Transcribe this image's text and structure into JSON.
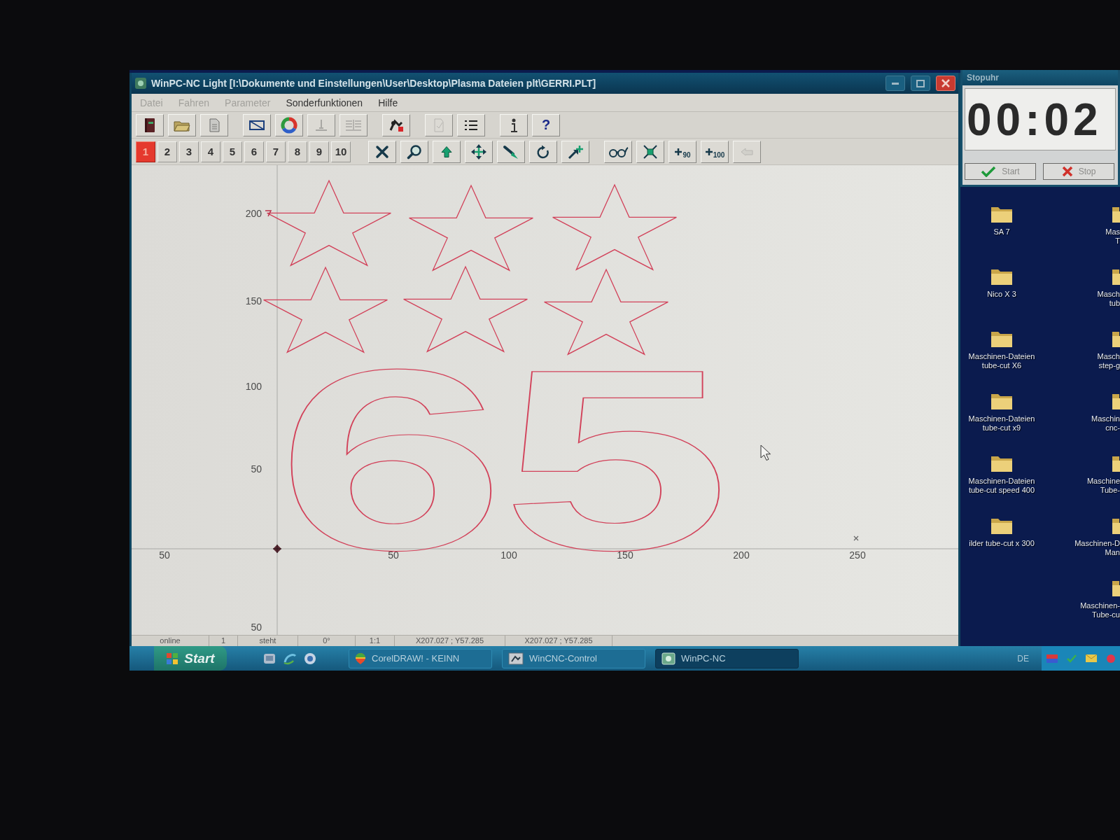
{
  "window": {
    "title": "WinPC-NC Light [I:\\Dokumente und Einstellungen\\User\\Desktop\\Plasma Dateien plt\\GERRI.PLT]"
  },
  "menu": [
    {
      "label": "Datei",
      "disabled": true
    },
    {
      "label": "Fahren",
      "disabled": true
    },
    {
      "label": "Parameter",
      "disabled": true
    },
    {
      "label": "Sonderfunktionen",
      "disabled": false
    },
    {
      "label": "Hilfe",
      "disabled": false
    }
  ],
  "toolbar": [
    {
      "kind": "icon",
      "disabled": false
    },
    {
      "kind": "icon",
      "disabled": false
    },
    {
      "kind": "icon",
      "disabled": false
    },
    {
      "kind": "icon",
      "disabled": false
    },
    {
      "kind": "icon",
      "disabled": false
    },
    {
      "kind": "icon",
      "disabled": true
    },
    {
      "kind": "icon",
      "disabled": true
    },
    {
      "kind": "icon",
      "disabled": false
    },
    {
      "kind": "icon",
      "disabled": true
    },
    {
      "kind": "icon",
      "disabled": false
    },
    {
      "kind": "icon",
      "disabled": false
    },
    {
      "kind": "glyph",
      "label": "?",
      "disabled": false
    }
  ],
  "program_slots": [
    {
      "label": "1",
      "selected": true
    },
    {
      "label": "2",
      "selected": false
    },
    {
      "label": "3",
      "selected": false
    },
    {
      "label": "4",
      "selected": false
    },
    {
      "label": "5",
      "selected": false
    },
    {
      "label": "6",
      "selected": false
    },
    {
      "label": "7",
      "selected": false
    },
    {
      "label": "8",
      "selected": false
    },
    {
      "label": "9",
      "selected": false
    },
    {
      "label": "10",
      "selected": false
    }
  ],
  "tools": [
    {
      "kind": "icon",
      "disabled": false
    },
    {
      "kind": "icon",
      "disabled": false
    },
    {
      "kind": "icon",
      "disabled": false
    },
    {
      "kind": "icon",
      "disabled": false
    },
    {
      "kind": "icon",
      "disabled": false
    },
    {
      "kind": "icon",
      "disabled": false
    },
    {
      "kind": "icon",
      "disabled": false
    },
    {
      "kind": "icon",
      "disabled": false
    },
    {
      "kind": "icon",
      "disabled": false
    },
    {
      "kind": "plus",
      "label": "90",
      "disabled": false
    },
    {
      "kind": "plus",
      "label": "100",
      "disabled": false
    },
    {
      "kind": "icon",
      "disabled": true
    }
  ],
  "canvas": {
    "x_labels": [
      "50",
      "50",
      "100",
      "150",
      "200",
      "250"
    ],
    "y_labels": [
      "200",
      "150",
      "100",
      "50",
      "50"
    ],
    "outline_text": "65"
  },
  "status_bar": [
    "online",
    "1",
    "steht",
    "0°",
    "1:1",
    "X207.027 ; Y57.285",
    "X207.027 ; Y57.285"
  ],
  "stopwatch": {
    "title": "Stopuhr",
    "time": "00:02",
    "buttons": [
      {
        "kind": "start",
        "label": "Start"
      },
      {
        "kind": "stop",
        "label": "Stop"
      }
    ]
  },
  "desktop": {
    "column_1": [
      {
        "label": "SA 7"
      },
      {
        "label": "Nico X 3"
      },
      {
        "label": "Maschinen-Dateien\ntube-cut X6"
      },
      {
        "label": "Maschinen-Dateien\ntube-cut x9"
      },
      {
        "label": "Maschinen-Dateien\ntube-cut speed 400"
      },
      {
        "label": "ilder tube-cut x 300"
      }
    ],
    "column_2": [
      {
        "label": "Mas\nT"
      },
      {
        "label": "Masch\ntub"
      },
      {
        "label": "Masch\nstep-g"
      },
      {
        "label": "Maschin\ncnc-"
      },
      {
        "label": "Maschine\nTube-"
      },
      {
        "label": "Maschinen-D\nMan"
      },
      {
        "label": "Maschinen-\nTube-cu"
      }
    ]
  },
  "taskbar": {
    "start": "Start",
    "tasks": [
      {
        "label": "CorelDRAW! - KEINN",
        "selected": false
      },
      {
        "label": "WinCNC-Control",
        "selected": false
      },
      {
        "label": "WinPC-NC",
        "selected": true
      }
    ],
    "language": "DE"
  }
}
